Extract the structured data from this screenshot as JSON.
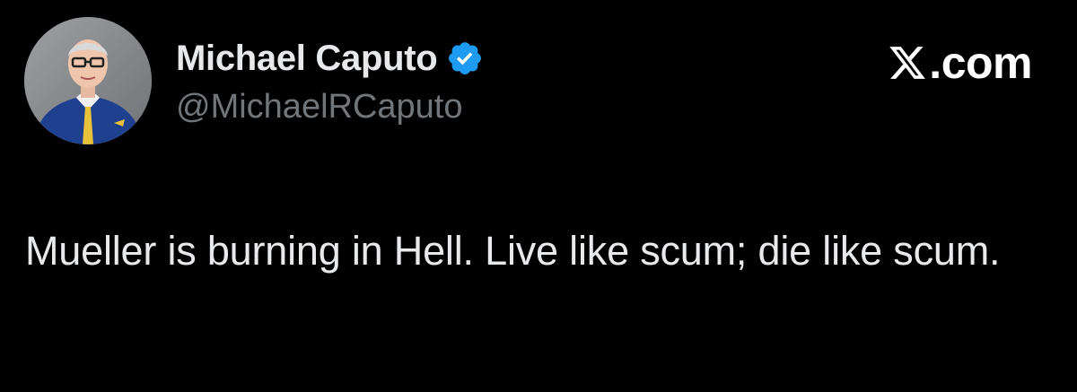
{
  "author": {
    "display_name": "Michael Caputo",
    "handle": "@MichaelRCaputo",
    "verified": true,
    "avatar_icon": "profile-photo"
  },
  "brand": {
    "logo_icon": "x-logo-icon",
    "text": ".com"
  },
  "tweet": {
    "text": "Mueller is burning in Hell. Live like scum; die like scum."
  },
  "colors": {
    "background": "#000000",
    "primary_text": "#e7e9ea",
    "secondary_text": "#71767b",
    "verified_blue": "#1d9bf0"
  }
}
